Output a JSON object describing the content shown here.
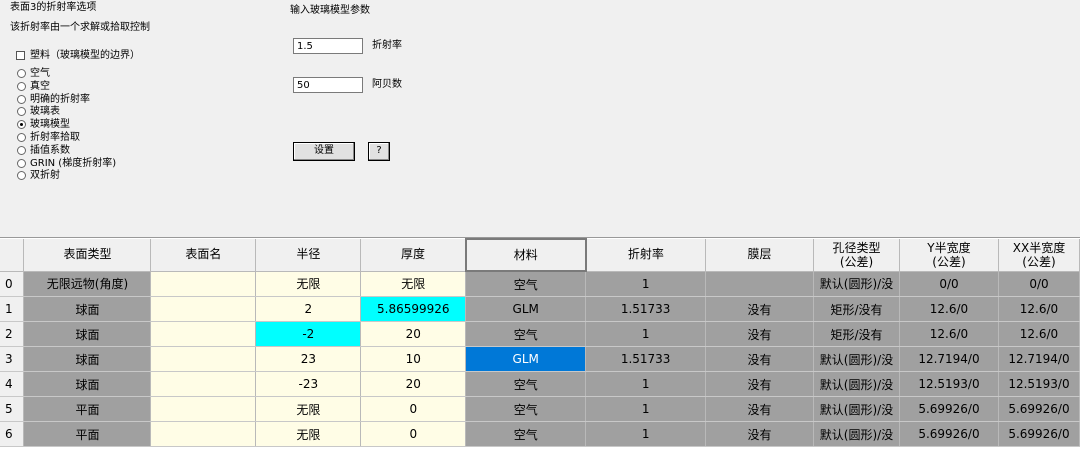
{
  "panel": {
    "title": "表面3的折射率选项",
    "subtitle": "该折射率由一个求解或拾取控制",
    "checkbox_label": "塑料（玻璃模型的边界）",
    "radios": [
      "空气",
      "真空",
      "明确的折射率",
      "玻璃表",
      "玻璃模型",
      "折射率拾取",
      "插值系数",
      "GRIN (梯度折射率)",
      "双折射"
    ],
    "selected_radio": "玻璃模型",
    "params_title": "输入玻璃模型参数",
    "index_value": "1.5",
    "index_label": "折射率",
    "abbe_value": "50",
    "abbe_label": "阿贝数",
    "set_button": "设置",
    "help_button": "?"
  },
  "grid": {
    "headers": [
      "表面类型",
      "表面名",
      "半径",
      "厚度",
      "材料",
      "折射率",
      "膜层",
      "孔径类型\n(公差)",
      "Y半宽度\n(公差)",
      "XX半宽度\n(公差)"
    ],
    "rows": [
      {
        "n": "0",
        "type": "无限远物(角度)",
        "name": "",
        "radius": "无限",
        "thickness": "无限",
        "material": "空气",
        "index": "1",
        "coating": "",
        "aperture": "默认(圆形)/没",
        "ysemi": "0/0",
        "xsemi": "0/0"
      },
      {
        "n": "1",
        "type": "球面",
        "name": "",
        "radius": "2",
        "thickness": "5.86599926",
        "material": "GLM",
        "index": "1.51733",
        "coating": "没有",
        "aperture": "矩形/没有",
        "ysemi": "12.6/0",
        "xsemi": "12.6/0"
      },
      {
        "n": "2",
        "type": "球面",
        "name": "",
        "radius": "-2",
        "thickness": "20",
        "material": "空气",
        "index": "1",
        "coating": "没有",
        "aperture": "矩形/没有",
        "ysemi": "12.6/0",
        "xsemi": "12.6/0"
      },
      {
        "n": "3",
        "type": "球面",
        "name": "",
        "radius": "23",
        "thickness": "10",
        "material": "GLM",
        "index": "1.51733",
        "coating": "没有",
        "aperture": "默认(圆形)/没",
        "ysemi": "12.7194/0",
        "xsemi": "12.7194/0"
      },
      {
        "n": "4",
        "type": "球面",
        "name": "",
        "radius": "-23",
        "thickness": "20",
        "material": "空气",
        "index": "1",
        "coating": "没有",
        "aperture": "默认(圆形)/没",
        "ysemi": "12.5193/0",
        "xsemi": "12.5193/0"
      },
      {
        "n": "5",
        "type": "平面",
        "name": "",
        "radius": "无限",
        "thickness": "0",
        "material": "空气",
        "index": "1",
        "coating": "没有",
        "aperture": "默认(圆形)/没",
        "ysemi": "5.69926/0",
        "xsemi": "5.69926/0"
      },
      {
        "n": "6",
        "type": "平面",
        "name": "",
        "radius": "无限",
        "thickness": "0",
        "material": "空气",
        "index": "1",
        "coating": "没有",
        "aperture": "默认(圆形)/没",
        "ysemi": "5.69926/0",
        "xsemi": "5.69926/0"
      }
    ]
  }
}
